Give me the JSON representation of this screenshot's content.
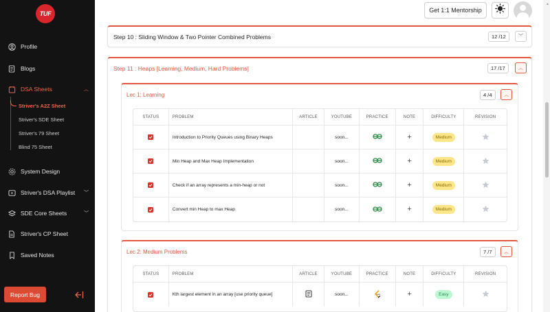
{
  "logo": "TUF",
  "sidebar": {
    "items": [
      {
        "label": "Profile",
        "icon": "profile-icon"
      },
      {
        "label": "Blogs",
        "icon": "blogs-icon"
      },
      {
        "label": "DSA Sheets",
        "icon": "sheets-icon"
      },
      {
        "label": "System Design",
        "icon": "system-design-icon"
      },
      {
        "label": "Striver's DSA Playlist",
        "icon": "play-icon"
      },
      {
        "label": "SDE Core Sheets",
        "icon": "core-sheets-icon"
      },
      {
        "label": "Striver's CP Sheet",
        "icon": "cp-sheet-icon"
      },
      {
        "label": "Saved Notes",
        "icon": "bookmark-icon"
      }
    ],
    "sub_items": [
      {
        "label": "Striver's A2Z Sheet"
      },
      {
        "label": "Striver's SDE Sheet"
      },
      {
        "label": "Striver's 79 Sheet"
      },
      {
        "label": "Blind 75 Sheet"
      }
    ],
    "report_bug": "Report Bug"
  },
  "header": {
    "mentorship": "Get 1:1 Mentorship"
  },
  "steps": [
    {
      "title": "Step 10 : Sliding Window & Two Pointer Combined Problems",
      "count": "12 /12"
    },
    {
      "title": "Step 11 : Heaps [Learning, Medium, Hard Problems]",
      "count": "17 /17"
    }
  ],
  "columns": [
    "STATUS",
    "PROBLEM",
    "ARTICLE",
    "YOUTUBE",
    "PRACTICE",
    "NOTE",
    "DIFFICULTY",
    "REVISION"
  ],
  "lectures": [
    {
      "title": "Lec 1: Learning",
      "count": "4 /4",
      "problems": [
        {
          "name": "Introduction to Priority Queues using Binary Heaps",
          "youtube": "soon...",
          "difficulty": "Medium"
        },
        {
          "name": "Min Heap and Max Heap Implementation",
          "youtube": "soon...",
          "difficulty": "Medium"
        },
        {
          "name": "Check if an array represents a min-heap or not",
          "youtube": "soon...",
          "difficulty": "Medium"
        },
        {
          "name": "Convert min Heap to max Heap",
          "youtube": "soon...",
          "difficulty": "Medium"
        }
      ]
    },
    {
      "title": "Lec 2: Medium Problems",
      "count": "7 /7",
      "problems": [
        {
          "name": "Kth largest element in an array [use priority queue]",
          "youtube": "soon...",
          "difficulty": "Easy"
        }
      ]
    }
  ],
  "colors": {
    "accent": "#e2563b",
    "sidebar_bg": "#131313",
    "medium": "#fde68a",
    "easy": "#bbf7d0"
  }
}
